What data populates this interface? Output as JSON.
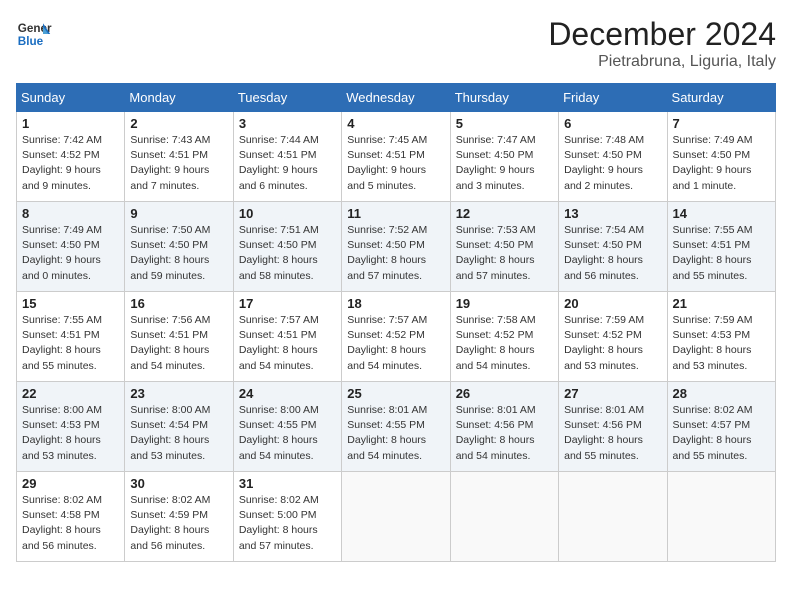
{
  "header": {
    "logo_line1": "General",
    "logo_line2": "Blue",
    "month": "December 2024",
    "location": "Pietrabruna, Liguria, Italy"
  },
  "weekdays": [
    "Sunday",
    "Monday",
    "Tuesday",
    "Wednesday",
    "Thursday",
    "Friday",
    "Saturday"
  ],
  "weeks": [
    [
      {
        "day": "1",
        "info": "Sunrise: 7:42 AM\nSunset: 4:52 PM\nDaylight: 9 hours\nand 9 minutes."
      },
      {
        "day": "2",
        "info": "Sunrise: 7:43 AM\nSunset: 4:51 PM\nDaylight: 9 hours\nand 7 minutes."
      },
      {
        "day": "3",
        "info": "Sunrise: 7:44 AM\nSunset: 4:51 PM\nDaylight: 9 hours\nand 6 minutes."
      },
      {
        "day": "4",
        "info": "Sunrise: 7:45 AM\nSunset: 4:51 PM\nDaylight: 9 hours\nand 5 minutes."
      },
      {
        "day": "5",
        "info": "Sunrise: 7:47 AM\nSunset: 4:50 PM\nDaylight: 9 hours\nand 3 minutes."
      },
      {
        "day": "6",
        "info": "Sunrise: 7:48 AM\nSunset: 4:50 PM\nDaylight: 9 hours\nand 2 minutes."
      },
      {
        "day": "7",
        "info": "Sunrise: 7:49 AM\nSunset: 4:50 PM\nDaylight: 9 hours\nand 1 minute."
      }
    ],
    [
      {
        "day": "8",
        "info": "Sunrise: 7:49 AM\nSunset: 4:50 PM\nDaylight: 9 hours\nand 0 minutes."
      },
      {
        "day": "9",
        "info": "Sunrise: 7:50 AM\nSunset: 4:50 PM\nDaylight: 8 hours\nand 59 minutes."
      },
      {
        "day": "10",
        "info": "Sunrise: 7:51 AM\nSunset: 4:50 PM\nDaylight: 8 hours\nand 58 minutes."
      },
      {
        "day": "11",
        "info": "Sunrise: 7:52 AM\nSunset: 4:50 PM\nDaylight: 8 hours\nand 57 minutes."
      },
      {
        "day": "12",
        "info": "Sunrise: 7:53 AM\nSunset: 4:50 PM\nDaylight: 8 hours\nand 57 minutes."
      },
      {
        "day": "13",
        "info": "Sunrise: 7:54 AM\nSunset: 4:50 PM\nDaylight: 8 hours\nand 56 minutes."
      },
      {
        "day": "14",
        "info": "Sunrise: 7:55 AM\nSunset: 4:51 PM\nDaylight: 8 hours\nand 55 minutes."
      }
    ],
    [
      {
        "day": "15",
        "info": "Sunrise: 7:55 AM\nSunset: 4:51 PM\nDaylight: 8 hours\nand 55 minutes."
      },
      {
        "day": "16",
        "info": "Sunrise: 7:56 AM\nSunset: 4:51 PM\nDaylight: 8 hours\nand 54 minutes."
      },
      {
        "day": "17",
        "info": "Sunrise: 7:57 AM\nSunset: 4:51 PM\nDaylight: 8 hours\nand 54 minutes."
      },
      {
        "day": "18",
        "info": "Sunrise: 7:57 AM\nSunset: 4:52 PM\nDaylight: 8 hours\nand 54 minutes."
      },
      {
        "day": "19",
        "info": "Sunrise: 7:58 AM\nSunset: 4:52 PM\nDaylight: 8 hours\nand 54 minutes."
      },
      {
        "day": "20",
        "info": "Sunrise: 7:59 AM\nSunset: 4:52 PM\nDaylight: 8 hours\nand 53 minutes."
      },
      {
        "day": "21",
        "info": "Sunrise: 7:59 AM\nSunset: 4:53 PM\nDaylight: 8 hours\nand 53 minutes."
      }
    ],
    [
      {
        "day": "22",
        "info": "Sunrise: 8:00 AM\nSunset: 4:53 PM\nDaylight: 8 hours\nand 53 minutes."
      },
      {
        "day": "23",
        "info": "Sunrise: 8:00 AM\nSunset: 4:54 PM\nDaylight: 8 hours\nand 53 minutes."
      },
      {
        "day": "24",
        "info": "Sunrise: 8:00 AM\nSunset: 4:55 PM\nDaylight: 8 hours\nand 54 minutes."
      },
      {
        "day": "25",
        "info": "Sunrise: 8:01 AM\nSunset: 4:55 PM\nDaylight: 8 hours\nand 54 minutes."
      },
      {
        "day": "26",
        "info": "Sunrise: 8:01 AM\nSunset: 4:56 PM\nDaylight: 8 hours\nand 54 minutes."
      },
      {
        "day": "27",
        "info": "Sunrise: 8:01 AM\nSunset: 4:56 PM\nDaylight: 8 hours\nand 55 minutes."
      },
      {
        "day": "28",
        "info": "Sunrise: 8:02 AM\nSunset: 4:57 PM\nDaylight: 8 hours\nand 55 minutes."
      }
    ],
    [
      {
        "day": "29",
        "info": "Sunrise: 8:02 AM\nSunset: 4:58 PM\nDaylight: 8 hours\nand 56 minutes."
      },
      {
        "day": "30",
        "info": "Sunrise: 8:02 AM\nSunset: 4:59 PM\nDaylight: 8 hours\nand 56 minutes."
      },
      {
        "day": "31",
        "info": "Sunrise: 8:02 AM\nSunset: 5:00 PM\nDaylight: 8 hours\nand 57 minutes."
      },
      null,
      null,
      null,
      null
    ]
  ]
}
